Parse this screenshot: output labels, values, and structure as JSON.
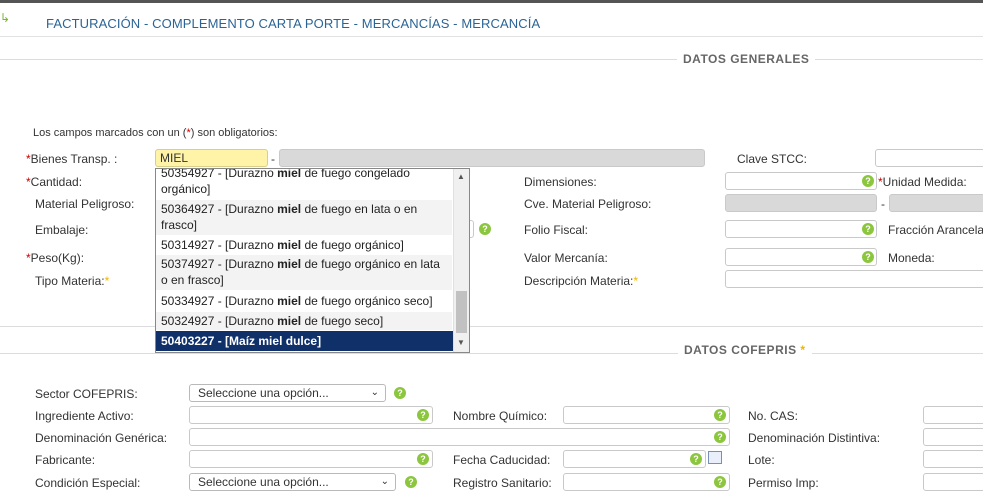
{
  "header": {
    "title": "FACTURACIÓN - COMPLEMENTO CARTA PORTE - MERCANCÍAS - MERCANCÍA"
  },
  "sections": {
    "general": "DATOS GENERALES",
    "cofepris": "DATOS COFEPRIS",
    "cofepris_star": "*"
  },
  "notice": {
    "pre": "Los campos marcados con un (",
    "mark": "*",
    "post": ") son obligatorios:"
  },
  "general": {
    "bienes_label": "Bienes Transp. :",
    "bienes_value": "MIEL",
    "dash": "-",
    "clave_stcc": "Clave STCC:",
    "cantidad": "Cantidad:",
    "dimensiones": "Dimensiones:",
    "unidad_medida": "Unidad Medida:",
    "material_peligroso": "Material Peligroso:",
    "cve_material": "Cve. Material Peligroso:",
    "embalaje": "Embalaje:",
    "folio_fiscal": "Folio Fiscal:",
    "fraccion": "Fracción Arancelaria",
    "peso": "Peso(Kg):",
    "valor_mercancia": "Valor Mercanía:",
    "moneda": "Moneda:",
    "tipo_materia": "Tipo Materia:",
    "descripcion_materia": "Descripción Materia:",
    "star": "*",
    "req": "*"
  },
  "dropdown": {
    "options": [
      {
        "pre": "50354927 - [Durazno ",
        "bold": "miel",
        "post": " de fuego congelado",
        "line2": "orgánico]"
      },
      {
        "pre": "50364927 - [Durazno ",
        "bold": "miel",
        "post": " de fuego en lata o en",
        "line2": "frasco]"
      },
      {
        "pre": "50314927 - [Durazno ",
        "bold": "miel",
        "post": " de fuego orgánico]",
        "line2": ""
      },
      {
        "pre": "50374927 - [Durazno ",
        "bold": "miel",
        "post": " de fuego orgánico en lata",
        "line2": "o en frasco]"
      },
      {
        "pre": "50334927 - [Durazno ",
        "bold": "miel",
        "post": " de fuego orgánico seco]",
        "line2": ""
      },
      {
        "pre": "50324927 - [Durazno ",
        "bold": "miel",
        "post": " de fuego seco]",
        "line2": ""
      },
      {
        "pre": "50403227 - [Maíz ",
        "bold": "miel",
        "post": " dulce]",
        "line2": ""
      }
    ],
    "selected_index": 6,
    "scroll_position": 0.85
  },
  "cofepris": {
    "sector": "Sector COFEPRIS:",
    "sector_value": "Seleccione una opción...",
    "ingrediente": "Ingrediente Activo:",
    "nombre_quimico": "Nombre Químico:",
    "no_cas": "No. CAS:",
    "denominacion_generica": "Denominación Genérica:",
    "denominacion_distintiva": "Denominación Distintiva:",
    "fabricante": "Fabricante:",
    "fecha_caducidad": "Fecha Caducidad:",
    "lote": "Lote:",
    "condicion_especial": "Condición Especial:",
    "condicion_value": "Seleccione una opción...",
    "registro_sanitario": "Registro Sanitario:",
    "permiso_imp": "Permiso Imp:"
  },
  "icons": {
    "help": "?",
    "chevron": "❯",
    "calendar": "calendar-icon",
    "arrow": "⬏"
  },
  "colors": {
    "accent": "#2a6496",
    "help": "#8cc63f",
    "selected": "#10306a",
    "required": "#cc0000",
    "star": "#f0b400"
  }
}
